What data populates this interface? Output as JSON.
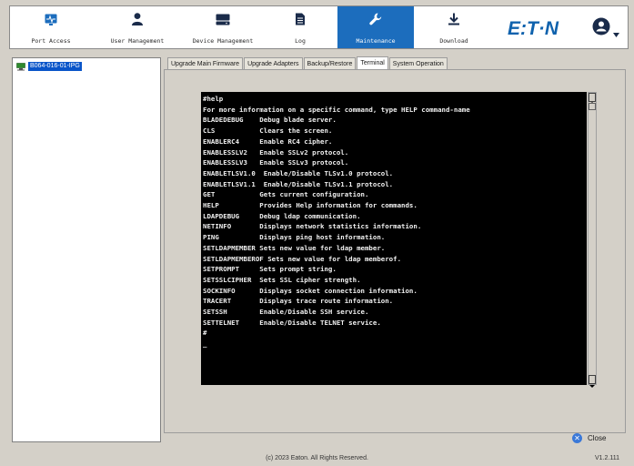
{
  "header": {
    "tabs": [
      {
        "label": "Port Access",
        "icon": "port-access-icon"
      },
      {
        "label": "User Management",
        "icon": "user-icon"
      },
      {
        "label": "Device Management",
        "icon": "device-icon"
      },
      {
        "label": "Log",
        "icon": "document-icon"
      },
      {
        "label": "Maintenance",
        "icon": "wrench-icon",
        "active": true
      },
      {
        "label": "Download",
        "icon": "download-icon"
      }
    ],
    "logo_text": "E:T·N",
    "accent_color": "#1c6dbd"
  },
  "sidebar": {
    "items": [
      {
        "label": "B064-016-01-IPG",
        "icon": "server-icon",
        "selected": true
      }
    ]
  },
  "main": {
    "tabs": [
      {
        "label": "Upgrade Main Firmware"
      },
      {
        "label": "Upgrade Adapters"
      },
      {
        "label": "Backup/Restore"
      },
      {
        "label": "Terminal",
        "active": true
      },
      {
        "label": "System Operation"
      }
    ],
    "terminal": {
      "lines": [
        "#help",
        "For more information on a specific command, type HELP command-name",
        "BLADEDEBUG    Debug blade server.",
        "CLS           Clears the screen.",
        "ENABLERC4     Enable RC4 cipher.",
        "ENABLESSLV2   Enable SSLv2 protocol.",
        "ENABLESSLV3   Enable SSLv3 protocol.",
        "ENABLETLSV1.0  Enable/Disable TLSv1.0 protocol.",
        "ENABLETLSV1.1  Enable/Disable TLSv1.1 protocol.",
        "GET           Gets current configuration.",
        "HELP          Provides Help information for commands.",
        "LDAPDEBUG     Debug ldap communication.",
        "NETINFO       Displays network statistics information.",
        "PING          Displays ping host information.",
        "SETLDAPMEMBER Sets new value for ldap member.",
        "SETLDAPMEMBEROF Sets new value for ldap memberof.",
        "SETPROMPT     Sets prompt string.",
        "SETSSLCIPHER  Sets SSL cipher strength.",
        "SOCKINFO      Displays socket connection information.",
        "TRACERT       Displays trace route information.",
        "SETSSH        Enable/Disable SSH service.",
        "SETTELNET     Enable/Disable TELNET service.",
        "#",
        "_"
      ]
    }
  },
  "footer": {
    "close_label": "Close",
    "copyright": "(c) 2023 Eaton. All Rights Reserved.",
    "version": "V1.2.111"
  }
}
